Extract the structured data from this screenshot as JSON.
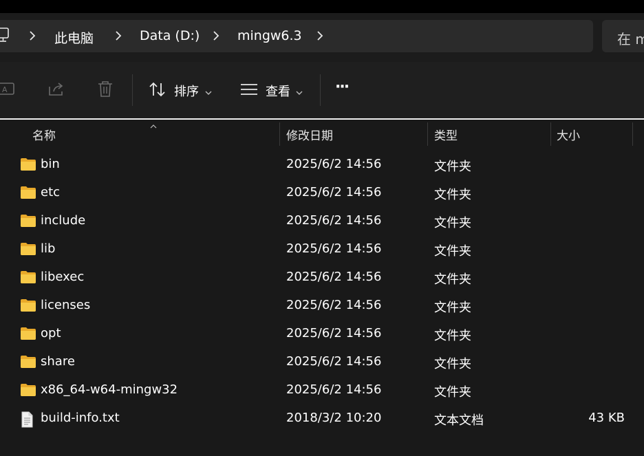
{
  "address_bar": {
    "breadcrumbs": [
      "此电脑",
      "Data (D:)",
      "mingw6.3"
    ]
  },
  "search": {
    "placeholder": "在 m"
  },
  "toolbar": {
    "sort_label": "排序",
    "view_label": "查看",
    "more_label": "···"
  },
  "columns": {
    "name": "名称",
    "date": "修改日期",
    "type": "类型",
    "size": "大小"
  },
  "files": [
    {
      "name": "bin",
      "date": "2025/6/2 14:56",
      "type": "文件夹",
      "size": "",
      "icon": "folder-icon"
    },
    {
      "name": "etc",
      "date": "2025/6/2 14:56",
      "type": "文件夹",
      "size": "",
      "icon": "folder-icon"
    },
    {
      "name": "include",
      "date": "2025/6/2 14:56",
      "type": "文件夹",
      "size": "",
      "icon": "folder-icon"
    },
    {
      "name": "lib",
      "date": "2025/6/2 14:56",
      "type": "文件夹",
      "size": "",
      "icon": "folder-icon"
    },
    {
      "name": "libexec",
      "date": "2025/6/2 14:56",
      "type": "文件夹",
      "size": "",
      "icon": "folder-icon"
    },
    {
      "name": "licenses",
      "date": "2025/6/2 14:56",
      "type": "文件夹",
      "size": "",
      "icon": "folder-icon"
    },
    {
      "name": "opt",
      "date": "2025/6/2 14:56",
      "type": "文件夹",
      "size": "",
      "icon": "folder-icon"
    },
    {
      "name": "share",
      "date": "2025/6/2 14:56",
      "type": "文件夹",
      "size": "",
      "icon": "folder-icon"
    },
    {
      "name": "x86_64-w64-mingw32",
      "date": "2025/6/2 14:56",
      "type": "文件夹",
      "size": "",
      "icon": "folder-icon"
    },
    {
      "name": "build-info.txt",
      "date": "2018/3/2 10:20",
      "type": "文本文档",
      "size": "43 KB",
      "icon": "text-file-icon"
    }
  ],
  "colors": {
    "background": "#191919",
    "folder": "#f5c542",
    "text": "#ffffff"
  }
}
